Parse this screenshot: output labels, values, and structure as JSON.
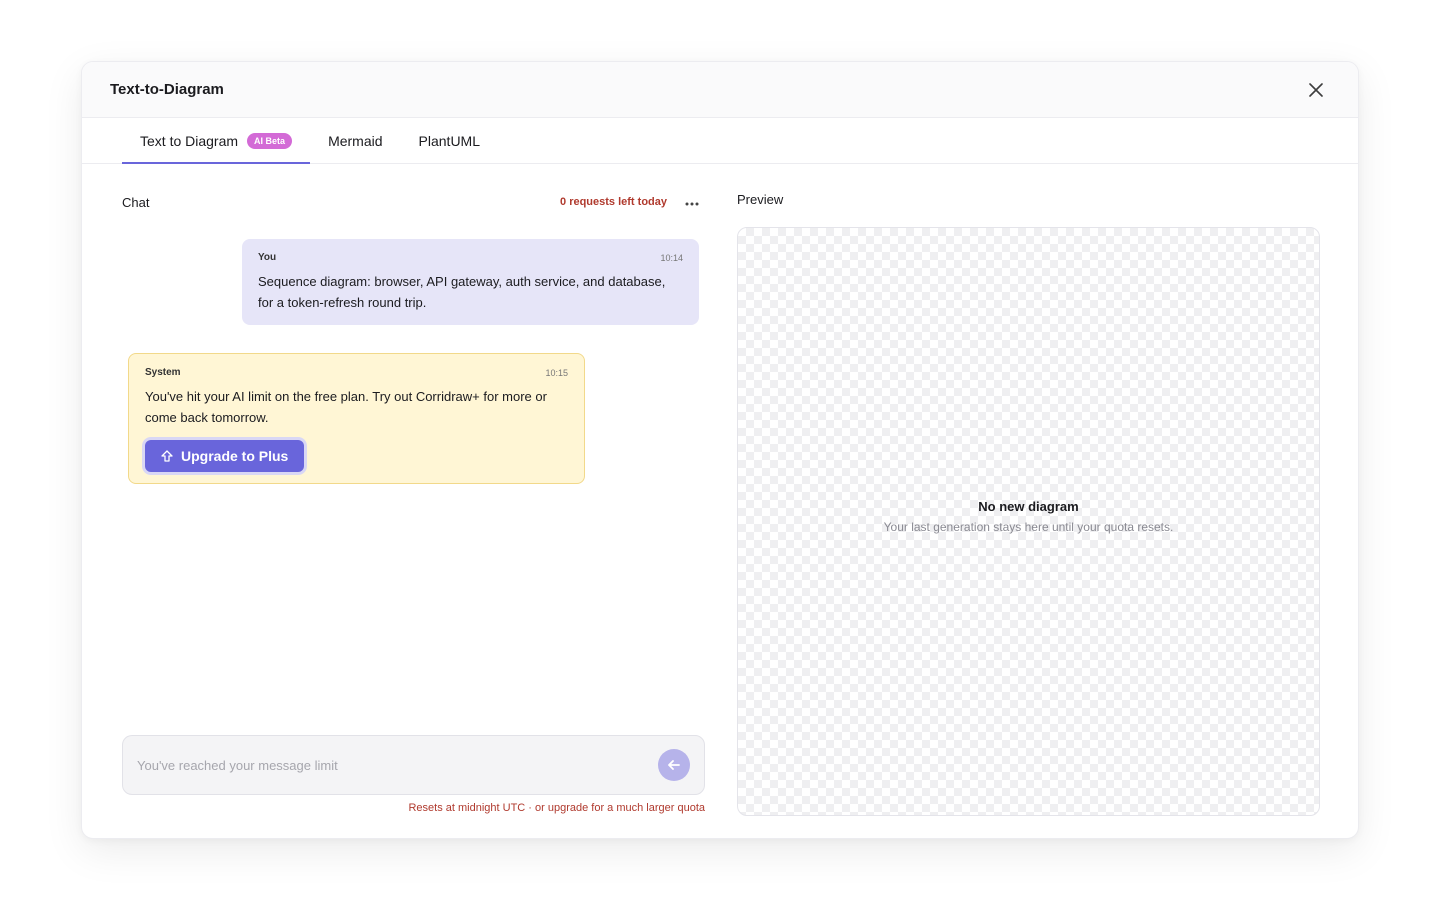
{
  "dialog": {
    "title": "Text-to-Diagram"
  },
  "tabs": [
    {
      "label": "Text to Diagram",
      "badge": "AI Beta",
      "active": true
    },
    {
      "label": "Mermaid",
      "active": false
    },
    {
      "label": "PlantUML",
      "active": false
    }
  ],
  "chat": {
    "label": "Chat",
    "requests_left": "0 requests left today",
    "messages": [
      {
        "author": "You",
        "time": "10:14",
        "text": "Sequence diagram: browser, API gateway, auth service, and database, for a token-refresh round trip."
      },
      {
        "author": "System",
        "time": "10:15",
        "text": "You've hit your AI limit on the free plan. Try out Corridraw+ for more or come back tomorrow.",
        "button": "Upgrade to Plus"
      }
    ],
    "input_placeholder": "You've reached your message limit",
    "reset_note": "Resets at midnight UTC · or upgrade for a much larger quota"
  },
  "preview": {
    "label": "Preview",
    "empty_title": "No new diagram",
    "empty_subtitle": "Your last generation stays here until your quota resets."
  },
  "colors": {
    "accent": "#6965db",
    "badge": "#d36ad6",
    "warning_text": "#b03a2e",
    "user_bubble": "#e6e5f8",
    "system_bubble": "#fff6d5"
  }
}
